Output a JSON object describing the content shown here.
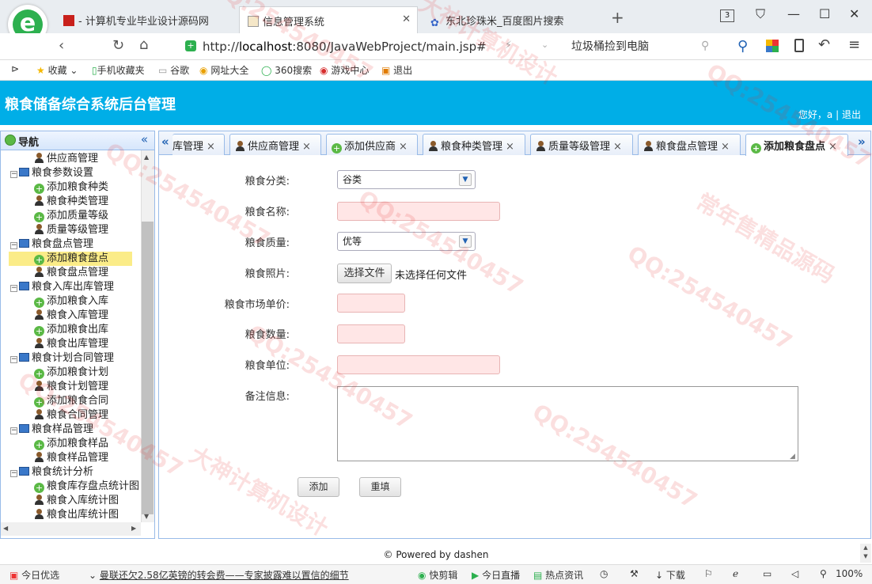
{
  "browser": {
    "tabs": [
      {
        "title": "- 计算机专业毕业设计源码网",
        "active": false
      },
      {
        "title": "信息管理系统",
        "active": true
      },
      {
        "title": "东北珍珠米_百度图片搜索",
        "active": false
      }
    ],
    "tab_count": "3",
    "url_prefix": "http://",
    "url_host": "localhost",
    "url_rest": ":8080/JavaWebProject/main.jsp#",
    "search_text": "垃圾桶捡到电脑",
    "favorites": [
      "收藏",
      "手机收藏夹",
      "谷歌",
      "网址大全",
      "360搜索",
      "游戏中心",
      "退出"
    ]
  },
  "app": {
    "title": "粮食储备综合系统后台管理",
    "greeting": "您好，a",
    "separator": "|",
    "logout": "退出"
  },
  "sidebar": {
    "title": "导航",
    "collapse": "«",
    "items": [
      {
        "label": "供应商管理",
        "level": 2,
        "icon": "user-icon"
      },
      {
        "label": "粮食参数设置",
        "level": 1,
        "icon": "computer-icon"
      },
      {
        "label": "添加粮食种类",
        "level": 2,
        "icon": "add-icon"
      },
      {
        "label": "粮食种类管理",
        "level": 2,
        "icon": "user-icon"
      },
      {
        "label": "添加质量等级",
        "level": 2,
        "icon": "add-icon"
      },
      {
        "label": "质量等级管理",
        "level": 2,
        "icon": "user-icon"
      },
      {
        "label": "粮食盘点管理",
        "level": 1,
        "icon": "computer-icon"
      },
      {
        "label": "添加粮食盘点",
        "level": 2,
        "icon": "add-icon",
        "selected": true
      },
      {
        "label": "粮食盘点管理",
        "level": 2,
        "icon": "user-icon"
      },
      {
        "label": "粮食入库出库管理",
        "level": 1,
        "icon": "computer-icon"
      },
      {
        "label": "添加粮食入库",
        "level": 2,
        "icon": "add-icon"
      },
      {
        "label": "粮食入库管理",
        "level": 2,
        "icon": "user-icon"
      },
      {
        "label": "添加粮食出库",
        "level": 2,
        "icon": "add-icon"
      },
      {
        "label": "粮食出库管理",
        "level": 2,
        "icon": "user-icon"
      },
      {
        "label": "粮食计划合同管理",
        "level": 1,
        "icon": "computer-icon"
      },
      {
        "label": "添加粮食计划",
        "level": 2,
        "icon": "add-icon"
      },
      {
        "label": "粮食计划管理",
        "level": 2,
        "icon": "user-icon"
      },
      {
        "label": "添加粮食合同",
        "level": 2,
        "icon": "add-icon"
      },
      {
        "label": "粮食合同管理",
        "level": 2,
        "icon": "user-icon"
      },
      {
        "label": "粮食样品管理",
        "level": 1,
        "icon": "computer-icon"
      },
      {
        "label": "添加粮食样品",
        "level": 2,
        "icon": "add-icon"
      },
      {
        "label": "粮食样品管理",
        "level": 2,
        "icon": "user-icon"
      },
      {
        "label": "粮食统计分析",
        "level": 1,
        "icon": "computer-icon"
      },
      {
        "label": "粮食库存盘点统计图",
        "level": 2,
        "icon": "add-icon"
      },
      {
        "label": "粮食入库统计图",
        "level": 2,
        "icon": "user-icon"
      },
      {
        "label": "粮食出库统计图",
        "level": 2,
        "icon": "user-icon"
      }
    ]
  },
  "content_tabs": [
    {
      "label": "库管理",
      "icon": "none"
    },
    {
      "label": "供应商管理",
      "icon": "user-icon"
    },
    {
      "label": "添加供应商",
      "icon": "add-icon"
    },
    {
      "label": "粮食种类管理",
      "icon": "user-icon"
    },
    {
      "label": "质量等级管理",
      "icon": "user-icon"
    },
    {
      "label": "粮食盘点管理",
      "icon": "user-icon"
    },
    {
      "label": "添加粮食盘点",
      "icon": "add-icon",
      "active": true
    }
  ],
  "tab_close": "×",
  "form": {
    "category_label": "粮食分类:",
    "category_value": "谷类",
    "name_label": "粮食名称:",
    "quality_label": "粮食质量:",
    "quality_value": "优等",
    "photo_label": "粮食照片:",
    "photo_button": "选择文件",
    "photo_status": "未选择任何文件",
    "price_label": "粮食市场单价:",
    "quantity_label": "粮食数量:",
    "unit_label": "粮食单位:",
    "remark_label": "备注信息:",
    "submit": "添加",
    "reset": "重填"
  },
  "footer": "© Powered by dashen",
  "statusbar": {
    "left": "今日优选",
    "news": "曼联还欠2.58亿英镑的转会费——专家披露难以置信的细节",
    "items": [
      "快剪辑",
      "今日直播",
      "热点资讯",
      "下载"
    ],
    "zoom": "100%"
  },
  "watermarks": [
    "QQ:254540457",
    "大神计算机设计",
    "常年售精品源码"
  ]
}
